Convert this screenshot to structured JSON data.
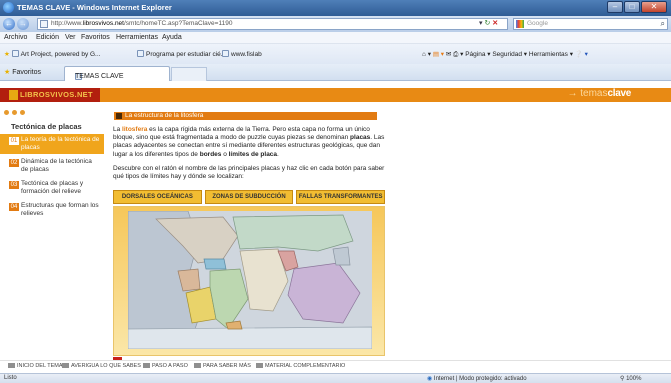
{
  "window": {
    "title": "TEMAS CLAVE - Windows Internet Explorer",
    "min_glyph": "–",
    "max_glyph": "□",
    "close_glyph": "✕"
  },
  "address": {
    "url_prefix": "http://www.",
    "url_domain": "librosvivos.net",
    "url_path": "/smtc/homeTC.asp?TemaClave=1190",
    "search_placeholder": "Google",
    "refresh_glyph": "↻",
    "stop_glyph": "✕",
    "dropdown_glyph": "▾",
    "search_glyph": "⌕"
  },
  "menu": [
    "Archivo",
    "Edición",
    "Ver",
    "Favoritos",
    "Herramientas",
    "Ayuda"
  ],
  "links": [
    "Art Project, powered by G...",
    "Programa per estudiar cié...",
    "www.fislab"
  ],
  "commandbar": {
    "pagina": "Página",
    "seguridad": "Seguridad",
    "herramientas": "Herramientas"
  },
  "favbar": {
    "favorites": "Favoritos",
    "tab_title": "TEMAS CLAVE"
  },
  "site": {
    "logo": "LIBROSVIVOS.NET",
    "brand_prefix": "→ temas",
    "brand_bold": "clave"
  },
  "sidebar": {
    "title": "Tectónica de placas",
    "items": [
      {
        "num": "01",
        "label": "La teoría de la tectónica de placas",
        "active": true
      },
      {
        "num": "02",
        "label": "Dinámica de la tectónica de placas",
        "active": false
      },
      {
        "num": "03",
        "label": "Tectónica de placas y formación del relieve",
        "active": false
      },
      {
        "num": "04",
        "label": "Estructuras que forman los relieves",
        "active": false
      }
    ]
  },
  "content": {
    "section_title": "La estructura de la litosfera",
    "p1_a": "La ",
    "p1_hl": "litosfera",
    "p1_b": " es la capa rígida más externa de la Tierra. Pero esta capa no forma un único bloque, sino que está fragmentada a modo de puzzle cuyas piezas se denominan ",
    "p1_placas": "placas",
    "p1_c": ". Las placas adyacentes se conectan entre sí mediante diferentes estructuras geológicas, que dan lugar a los diferentes tipos de ",
    "p1_bordes": "bordes",
    "p1_d": " o ",
    "p1_limites": "límites de placa",
    "p1_e": ".",
    "p2": "Descubre con el ratón el nombre de las principales placas y haz clic en cada botón para saber qué tipos de límites hay y dónde se localizan:"
  },
  "buttons": [
    "DORSALES OCEÁNICAS",
    "ZONAS DE SUBDUCCIÓN",
    "FALLAS TRANSFORMANTES"
  ],
  "bottom_nav": [
    "INICIO DEL TEMA",
    "AVERIGUA LO QUE SABES",
    "PASO A PASO",
    "PARA SABER MÁS",
    "MATERIAL COMPLEMENTARIO"
  ],
  "status": {
    "left": "Listo",
    "zone": "Internet | Modo protegido: activado",
    "zoom": "100%"
  },
  "colors": {
    "accent_orange": "#e27b12",
    "header_orange": "#e88a14",
    "logo_red": "#b21f0e",
    "button_yellow": "#f2bd32"
  }
}
